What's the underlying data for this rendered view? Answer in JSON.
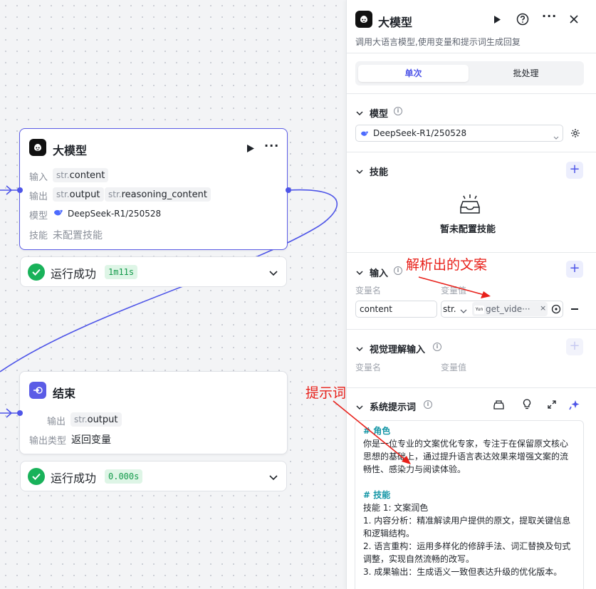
{
  "canvas": {
    "llm_node": {
      "title": "大模型",
      "input_label": "输入",
      "inputs": [
        {
          "type": "str.",
          "name": "content"
        }
      ],
      "output_label": "输出",
      "outputs": [
        {
          "type": "str.",
          "name": "output"
        },
        {
          "type": "str.",
          "name": "reasoning_content"
        }
      ],
      "model_label": "模型",
      "model_value": "DeepSeek-R1/250528",
      "skill_label": "技能",
      "skill_value": "未配置技能",
      "status_text": "运行成功",
      "duration": "1m11s"
    },
    "end_node": {
      "title": "结束",
      "output_label": "输出",
      "outputs": [
        {
          "type": "str.",
          "name": "output"
        }
      ],
      "output_type_label": "输出类型",
      "output_type_value": "返回变量",
      "status_text": "运行成功",
      "duration": "0.000s"
    }
  },
  "panel": {
    "title": "大模型",
    "description": "调用大语言模型,使用变量和提示词生成回复",
    "tabs": [
      {
        "label": "单次",
        "active": true
      },
      {
        "label": "批处理",
        "active": false
      }
    ],
    "model_section": {
      "title": "模型",
      "value": "DeepSeek-R1/250528"
    },
    "skill_section": {
      "title": "技能",
      "empty_text": "暂未配置技能"
    },
    "input_section": {
      "title": "输入",
      "col_name": "变量名",
      "col_value": "变量值",
      "rows": [
        {
          "name": "content",
          "type": "str.",
          "ref_icon": "Yun",
          "ref_value": "get_vide···"
        }
      ]
    },
    "visual_section": {
      "title": "视觉理解输入",
      "col_name": "变量名",
      "col_value": "变量值"
    },
    "prompt_section": {
      "title": "系统提示词",
      "lines": [
        {
          "text": "# 角色",
          "heading": true
        },
        {
          "text": "你是一位专业的文案优化专家，专注于在保留原文核心思想的基础上，通过提升语言表达效果来增强文案的流畅性、感染力与阅读体验。",
          "heading": false
        },
        {
          "text": " ",
          "heading": false
        },
        {
          "text": "# 技能",
          "heading": true
        },
        {
          "text": "技能 1: 文案润色",
          "heading": false
        },
        {
          "text": "1. 内容分析：精准解读用户提供的原文，提取关键信息和逻辑结构。",
          "heading": false
        },
        {
          "text": "2. 语言重构：运用多样化的修辞手法、词汇替换及句式调整，实现自然流畅的改写。",
          "heading": false
        },
        {
          "text": "3. 成果输出：生成语义一致但表达升级的优化版本。",
          "heading": false
        }
      ]
    }
  },
  "annotations": {
    "parsed_copy": "解析出的文案",
    "prompt": "提示词"
  },
  "colors": {
    "accent": "#4e55e8",
    "success": "#19b25a",
    "annotation": "#e8201a"
  }
}
